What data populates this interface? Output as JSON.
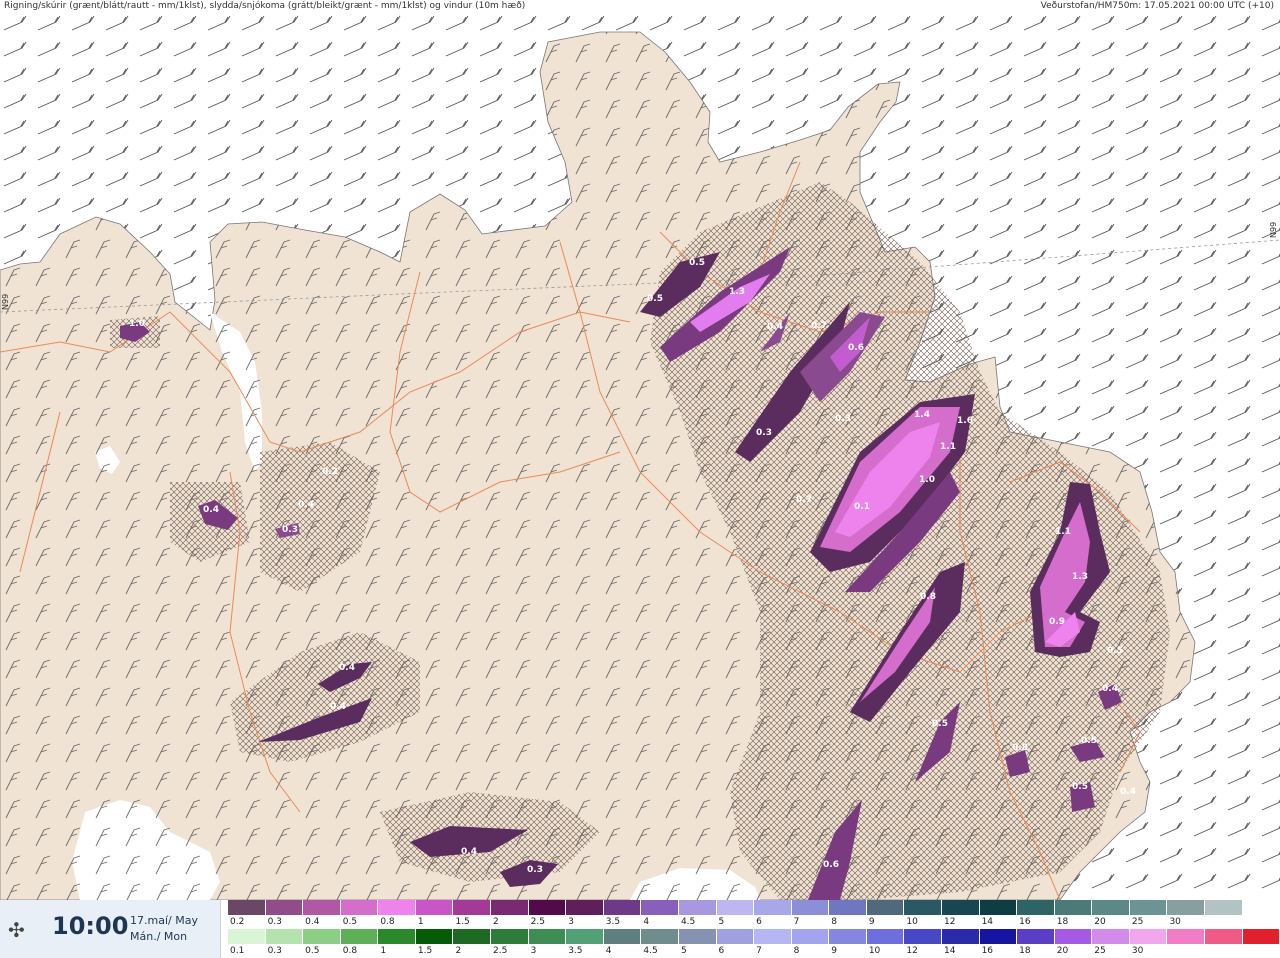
{
  "header": {
    "left": "Rigning/skúrir (grænt/blátt/rautt - mm/1klst), slydda/snjókoma (grátt/bleikt/grænt - mm/1klst) og vindur (10m hæð)",
    "right": "Veðurstofan/HM750m: 17.05.2021 00:00 UTC (+10)"
  },
  "map": {
    "grid_labels": [
      "N99",
      "N99"
    ],
    "precip_labels": [
      "1.0",
      "0.5",
      "0.5",
      "1.3",
      "0.4",
      "0.7",
      "0.6",
      "0.3",
      "0.3",
      "1.4",
      "1.6",
      "1.1",
      "1.0",
      "0.7",
      "0.1",
      "0.4",
      "0.3",
      "0.4",
      "0.8",
      "1.1",
      "1.3",
      "0.9",
      "0.5",
      "0.4",
      "0.4",
      "0.4",
      "0.5",
      "0.8",
      "0.5",
      "0.5",
      "0.4",
      "0.4",
      "0.3",
      "0.6",
      "0.2"
    ],
    "colors": {
      "sea": "#ffffff",
      "land": "#f1e3d4",
      "roads": "#e98a5a",
      "snow_dark": "#5b2d5e",
      "snow_mid": "#9a4fa4",
      "snow_light": "#e27df0",
      "hatch": "#6e5a52"
    }
  },
  "footer": {
    "wind_icon": "wind-station-icon",
    "time": "10:00",
    "date_line1": "17.maí/ May",
    "date_line2": "Mán./ Mon"
  },
  "legend": {
    "snow": {
      "colors": [
        "#6b4766",
        "#914c8a",
        "#b157a6",
        "#d46dcc",
        "#ef83ee",
        "#c955c8",
        "#a33a9a",
        "#7a2a72",
        "#520a4a",
        "#5e1f5b",
        "#6c3a88",
        "#8860bc",
        "#a798df",
        "#bdb6f1",
        "#a8a7ea",
        "#8b8fd8",
        "#6e77c0",
        "#50697d",
        "#2b5865",
        "#184753",
        "#0f3d44",
        "#2e6463",
        "#4b7b79",
        "#5c8888",
        "#6d9495",
        "#879f9f",
        "#b3c2c2",
        "#ffffff"
      ],
      "labels": [
        "0.2",
        "0.3",
        "0.4",
        "0.5",
        "0.8",
        "1",
        "1.5",
        "2",
        "2.5",
        "3",
        "3.5",
        "4",
        "4.5",
        "5",
        "6",
        "7",
        "8",
        "9",
        "10",
        "12",
        "14",
        "16",
        "18",
        "20",
        "25",
        "30",
        "",
        ""
      ]
    },
    "rain": {
      "colors": [
        "#d8f6d4",
        "#b4e3ad",
        "#8ccf84",
        "#5eaf58",
        "#2a8a2b",
        "#065c06",
        "#1f6a22",
        "#2f7c3a",
        "#3f8d55",
        "#52a076",
        "#5f7e7e",
        "#6f8d8d",
        "#8592b0",
        "#a0a0e0",
        "#b6b6f4",
        "#a4a4ee",
        "#8686de",
        "#6e6edc",
        "#4848c6",
        "#2b2baa",
        "#1515a0",
        "#5a3ec6",
        "#a65ae4",
        "#d48ae9",
        "#f2a6ee",
        "#f07dc6",
        "#ef5a86",
        "#e0202a"
      ],
      "labels": [
        "0.1",
        "0.3",
        "0.5",
        "0.8",
        "1",
        "1.5",
        "2",
        "2.5",
        "3",
        "3.5",
        "4",
        "4.5",
        "5",
        "6",
        "7",
        "8",
        "9",
        "10",
        "12",
        "14",
        "16",
        "18",
        "20",
        "25",
        "30",
        "",
        "",
        ""
      ]
    }
  }
}
